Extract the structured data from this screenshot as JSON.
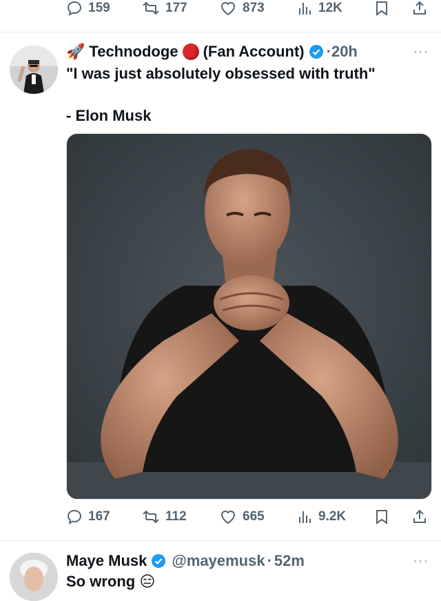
{
  "top_actions": {
    "replies": "159",
    "retweets": "177",
    "likes": "873",
    "views": "12K"
  },
  "tweet1": {
    "rocket_emoji": "🚀",
    "name": "Technodoge",
    "name_suffix": "(Fan Account)",
    "time": "20h",
    "text_line1": "\"I was just absolutely obsessed with truth\"",
    "text_line2": "- Elon Musk",
    "actions": {
      "replies": "167",
      "retweets": "112",
      "likes": "665",
      "views": "9.2K"
    }
  },
  "tweet2": {
    "name": "Maye Musk",
    "handle": "@mayemusk",
    "time": "52m",
    "text": "So wrong 😑"
  },
  "colors": {
    "verified": "#1d9bf0",
    "muted": "#536471",
    "red_circle": "#e0262b"
  }
}
